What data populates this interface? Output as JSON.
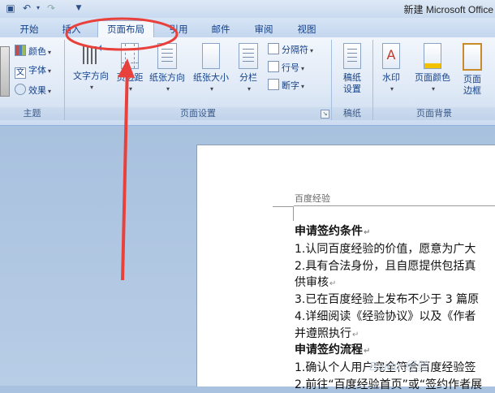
{
  "titlebar": {
    "title": "新建 Microsoft Office"
  },
  "tabs": [
    {
      "label": "开始"
    },
    {
      "label": "插入"
    },
    {
      "label": "页面布局"
    },
    {
      "label": "引用"
    },
    {
      "label": "邮件"
    },
    {
      "label": "审阅"
    },
    {
      "label": "视图"
    }
  ],
  "ribbon": {
    "theme": {
      "label": "主题",
      "colors": "颜色",
      "fonts": "字体",
      "effects": "效果"
    },
    "page_setup": {
      "label": "页面设置",
      "text_direction": "文字方向",
      "margins": "页边距",
      "orientation": "纸张方向",
      "size": "纸张大小",
      "columns": "分栏",
      "breaks": "分隔符",
      "line_numbers": "行号",
      "hyphenation": "断字"
    },
    "manuscript": {
      "label": "稿纸",
      "settings_line1": "稿纸",
      "settings_line2": "设置"
    },
    "page_background": {
      "label": "页面背景",
      "watermark": "水印",
      "page_color": "页面颜色",
      "borders_line1": "页面",
      "borders_line2": "边框"
    }
  },
  "document": {
    "header": "百度经验",
    "lines": [
      {
        "text": "申请签约条件"
      },
      {
        "text": "1.认同百度经验的价值，愿意为广大"
      },
      {
        "text": "2.具有合法身份，且自愿提供包括真"
      },
      {
        "text": "供审核"
      },
      {
        "text": "3.已在百度经验上发布不少于 3 篇原"
      },
      {
        "text": "4.详细阅读《经验协议》以及《作者"
      },
      {
        "text": "并遵照执行"
      },
      {
        "text": "申请签约流程"
      },
      {
        "text": "1.确认个人用户完全符合百度经验签"
      },
      {
        "text": "2.前往“百度经验首页”或“签约作者展"
      }
    ]
  },
  "annotation": {
    "highlight_color": "#e8413c"
  }
}
